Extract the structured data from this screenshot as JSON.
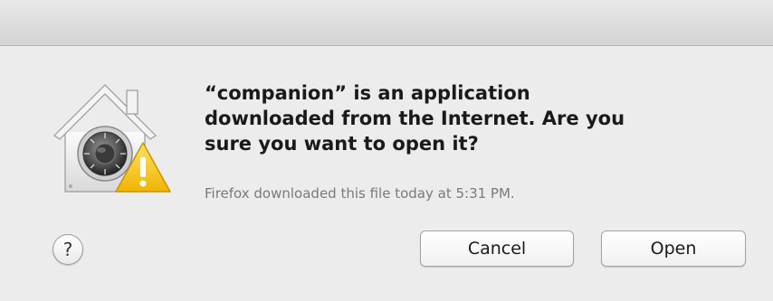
{
  "dialog": {
    "message_lines": [
      "“companion” is an application",
      "downloaded from the Internet. Are you",
      "sure you want to open it?"
    ],
    "subtext": "Firefox downloaded this file today at 5:31 PM.",
    "help_label": "?",
    "cancel_label": "Cancel",
    "open_label": "Open",
    "icon": "gatekeeper-warning-icon"
  },
  "colors": {
    "background": "#ececec",
    "warning": "#f2c21b"
  }
}
